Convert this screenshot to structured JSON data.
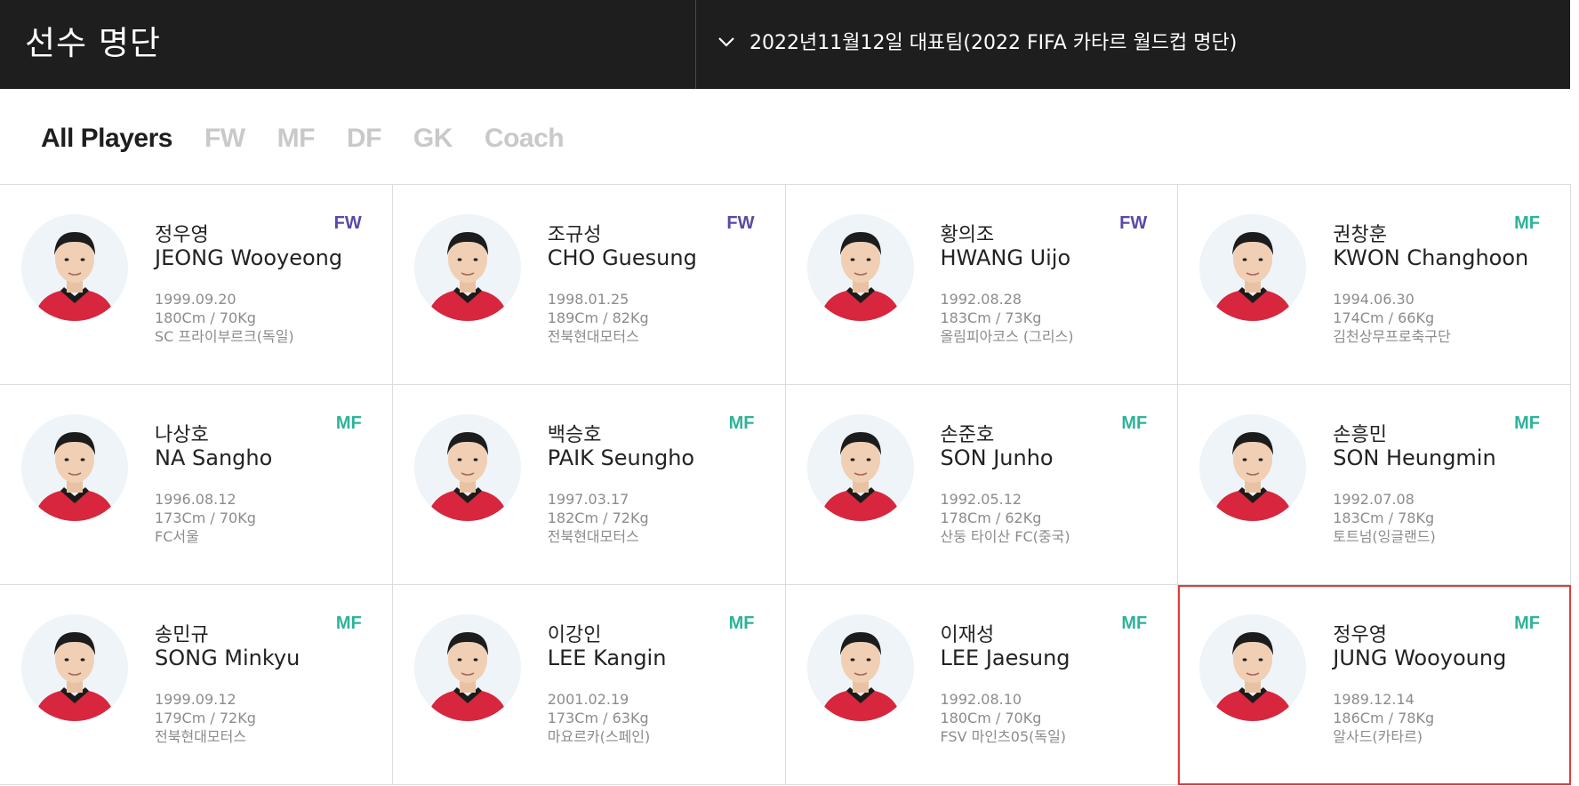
{
  "header": {
    "title": "선수 명단",
    "squad_selector": "2022년11월12일 대표팀(2022 FIFA 카타르 월드컵 명단)"
  },
  "colors": {
    "fw": "#5a48a8",
    "mf": "#2db39a",
    "selected_border": "#e03c3c"
  },
  "tabs": [
    {
      "label": "All Players",
      "active": true
    },
    {
      "label": "FW",
      "active": false
    },
    {
      "label": "MF",
      "active": false
    },
    {
      "label": "DF",
      "active": false
    },
    {
      "label": "GK",
      "active": false
    },
    {
      "label": "Coach",
      "active": false
    }
  ],
  "players": [
    {
      "name_ko": "정우영",
      "name_en": "JEONG Wooyeong",
      "birth": "1999.09.20",
      "body": "180Cm / 70Kg",
      "club": "SC 프라이부르크(독일)",
      "position": "FW"
    },
    {
      "name_ko": "조규성",
      "name_en": "CHO Guesung",
      "birth": "1998.01.25",
      "body": "189Cm / 82Kg",
      "club": "전북현대모터스",
      "position": "FW"
    },
    {
      "name_ko": "황의조",
      "name_en": "HWANG Uijo",
      "birth": "1992.08.28",
      "body": "183Cm / 73Kg",
      "club": "올림피아코스 (그리스)",
      "position": "FW"
    },
    {
      "name_ko": "권창훈",
      "name_en": "KWON Changhoon",
      "birth": "1994.06.30",
      "body": "174Cm / 66Kg",
      "club": "김천상무프로축구단",
      "position": "MF"
    },
    {
      "name_ko": "나상호",
      "name_en": "NA Sangho",
      "birth": "1996.08.12",
      "body": "173Cm / 70Kg",
      "club": "FC서울",
      "position": "MF"
    },
    {
      "name_ko": "백승호",
      "name_en": "PAIK Seungho",
      "birth": "1997.03.17",
      "body": "182Cm / 72Kg",
      "club": "전북현대모터스",
      "position": "MF"
    },
    {
      "name_ko": "손준호",
      "name_en": "SON Junho",
      "birth": "1992.05.12",
      "body": "178Cm / 62Kg",
      "club": "산둥 타이산 FC(중국)",
      "position": "MF"
    },
    {
      "name_ko": "손흥민",
      "name_en": "SON Heungmin",
      "birth": "1992.07.08",
      "body": "183Cm / 78Kg",
      "club": "토트넘(잉글랜드)",
      "position": "MF"
    },
    {
      "name_ko": "송민규",
      "name_en": "SONG Minkyu",
      "birth": "1999.09.12",
      "body": "179Cm / 72Kg",
      "club": "전북현대모터스",
      "position": "MF"
    },
    {
      "name_ko": "이강인",
      "name_en": "LEE Kangin",
      "birth": "2001.02.19",
      "body": "173Cm / 63Kg",
      "club": "마요르카(스페인)",
      "position": "MF"
    },
    {
      "name_ko": "이재성",
      "name_en": "LEE Jaesung",
      "birth": "1992.08.10",
      "body": "180Cm / 70Kg",
      "club": "FSV 마인츠05(독일)",
      "position": "MF"
    },
    {
      "name_ko": "정우영",
      "name_en": "JUNG Wooyoung",
      "birth": "1989.12.14",
      "body": "186Cm / 78Kg",
      "club": "알사드(카타르)",
      "position": "MF",
      "selected": true
    }
  ]
}
